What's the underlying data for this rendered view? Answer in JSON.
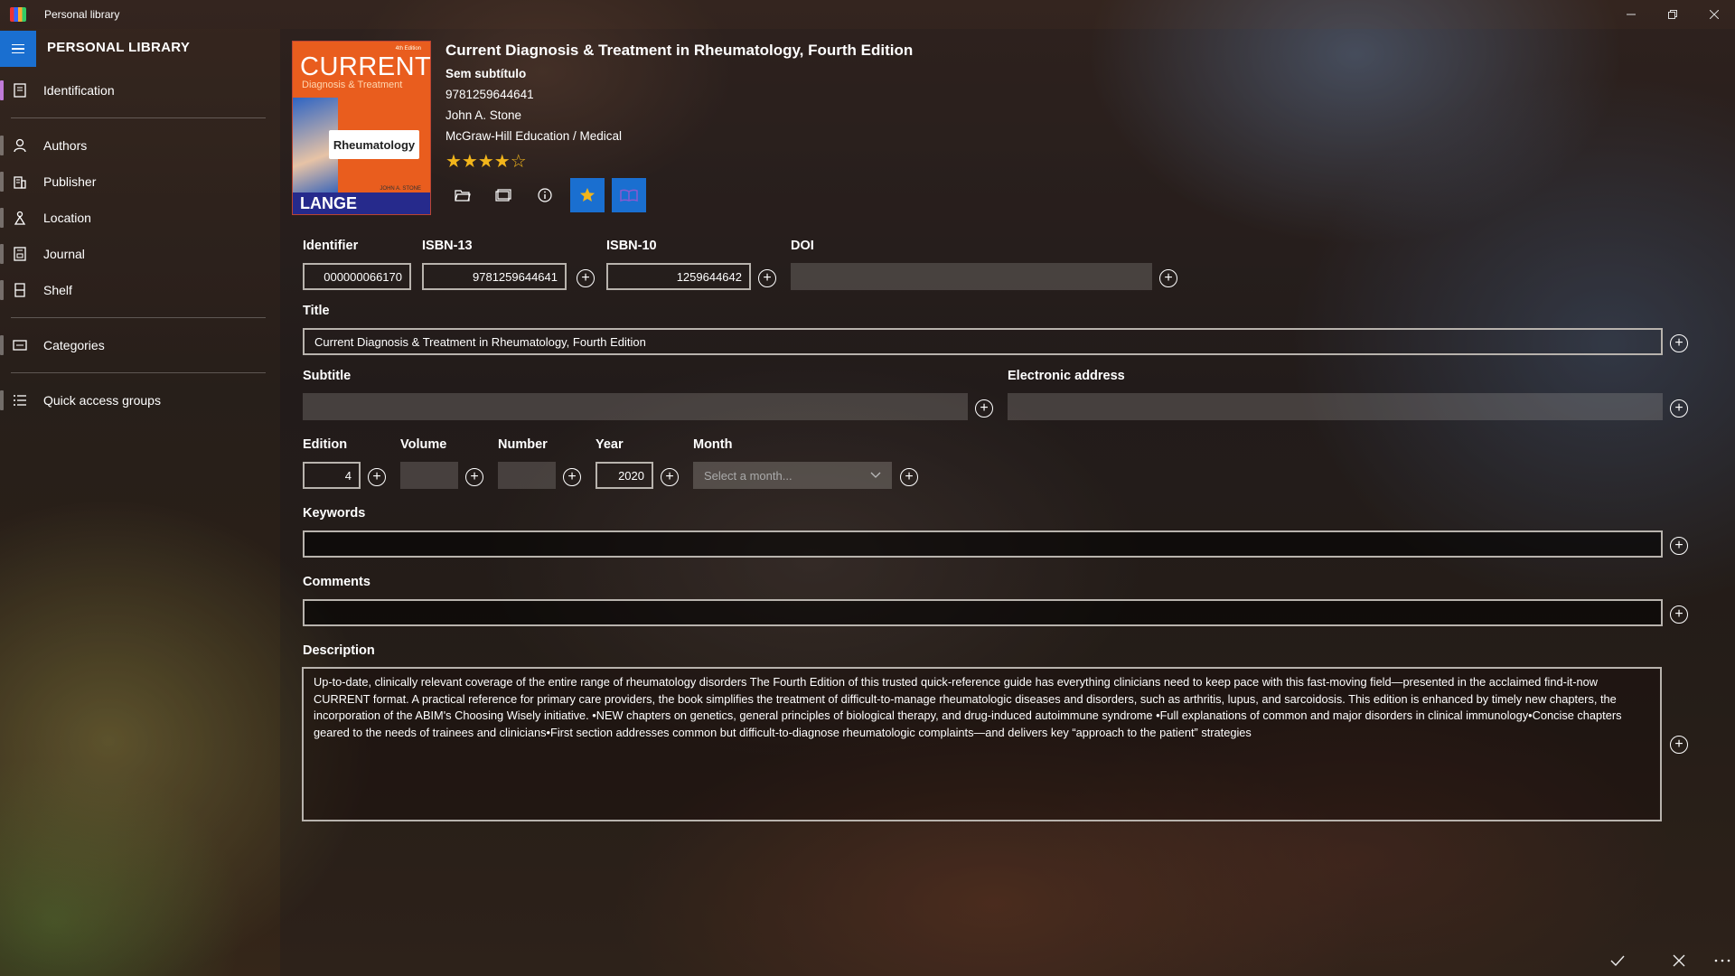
{
  "window": {
    "title": "Personal library"
  },
  "sidebar": {
    "app_name": "PERSONAL LIBRARY",
    "items": [
      {
        "label": "Identification",
        "icon": "id-card-icon"
      },
      {
        "label": "Authors",
        "icon": "person-icon"
      },
      {
        "label": "Publisher",
        "icon": "building-icon"
      },
      {
        "label": "Location",
        "icon": "map-pin-icon"
      },
      {
        "label": "Journal",
        "icon": "journal-icon"
      },
      {
        "label": "Shelf",
        "icon": "bookmark-icon"
      },
      {
        "label": "Categories",
        "icon": "tag-icon"
      },
      {
        "label": "Quick access groups",
        "icon": "list-icon"
      }
    ]
  },
  "book": {
    "cover": {
      "series": "CURRENT",
      "subseries": "Diagnosis & Treatment",
      "topic": "Rheumatology",
      "imprint": "LANGE",
      "edition_tag": "4th Edition",
      "author_tag": "JOHN A. STONE"
    },
    "title": "Current Diagnosis & Treatment in Rheumatology, Fourth Edition",
    "subtitle_display": "Sem subtítulo",
    "isbn": "9781259644641",
    "author": "John A. Stone",
    "publisher": "McGraw-Hill Education / Medical",
    "rating": 4,
    "rating_max": 5,
    "stars_text": "★★★★☆"
  },
  "form": {
    "identifier": {
      "label": "Identifier",
      "value": "000000066170"
    },
    "isbn13": {
      "label": "ISBN-13",
      "value": "9781259644641"
    },
    "isbn10": {
      "label": "ISBN-10",
      "value": "1259644642"
    },
    "doi": {
      "label": "DOI",
      "value": ""
    },
    "title": {
      "label": "Title",
      "value": "Current Diagnosis & Treatment in Rheumatology, Fourth Edition"
    },
    "subtitle": {
      "label": "Subtitle",
      "value": ""
    },
    "electronic_address": {
      "label": "Electronic address",
      "value": ""
    },
    "edition": {
      "label": "Edition",
      "value": "4"
    },
    "volume": {
      "label": "Volume",
      "value": ""
    },
    "number": {
      "label": "Number",
      "value": ""
    },
    "year": {
      "label": "Year",
      "value": "2020"
    },
    "month": {
      "label": "Month",
      "placeholder": "Select a month..."
    },
    "keywords": {
      "label": "Keywords",
      "value": ""
    },
    "comments": {
      "label": "Comments",
      "value": ""
    },
    "description": {
      "label": "Description",
      "value": "Up-to-date, clinically relevant coverage of the entire range of rheumatology disorders The Fourth Edition of this trusted quick-reference guide has everything clinicians need to keep pace with this fast-moving field—presented in the acclaimed find-it-now CURRENT format. A practical reference for primary care providers, the book simplifies the treatment of difficult-to-manage rheumatologic diseases and disorders, such as arthritis, lupus, and sarcoidosis. This edition is enhanced by timely new chapters, the incorporation of the ABIM's Choosing Wisely initiative. •NEW chapters on genetics, general principles of biological therapy, and drug-induced autoimmune syndrome •Full explanations of common and major disorders in clinical immunology•Concise chapters geared to the needs of trainees and clinicians•First section addresses common but difficult-to-diagnose rheumatologic complaints—and delivers key “approach to the patient” strategies"
    }
  },
  "plus_symbol": "+",
  "icons": {
    "folder": "folder-icon",
    "image": "image-icon",
    "info": "info-icon",
    "favorite": "star-icon",
    "read": "book-icon",
    "accept": "check-icon",
    "cancel": "close-icon",
    "more": "more-icon"
  },
  "colors": {
    "accent": "#1a6fd0",
    "star": "#f2b51b",
    "active_indicator": "#c07bd8"
  }
}
